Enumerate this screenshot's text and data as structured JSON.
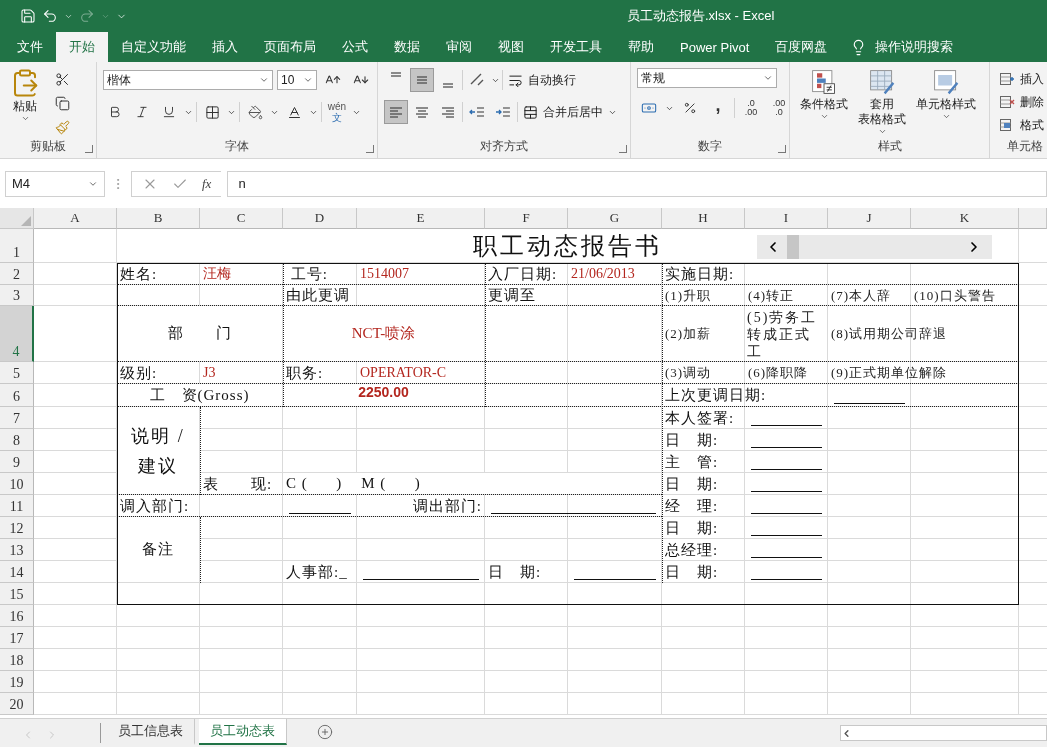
{
  "window": {
    "title": "员工动态报告.xlsx  -  Excel",
    "redo_enabled": false
  },
  "ribbon_tabs": [
    {
      "label": "文件",
      "selected": false
    },
    {
      "label": "开始",
      "selected": true
    },
    {
      "label": "自定义功能",
      "selected": false
    },
    {
      "label": "插入",
      "selected": false
    },
    {
      "label": "页面布局",
      "selected": false
    },
    {
      "label": "公式",
      "selected": false
    },
    {
      "label": "数据",
      "selected": false
    },
    {
      "label": "审阅",
      "selected": false
    },
    {
      "label": "视图",
      "selected": false
    },
    {
      "label": "开发工具",
      "selected": false
    },
    {
      "label": "帮助",
      "selected": false
    },
    {
      "label": "Power Pivot",
      "selected": false
    },
    {
      "label": "百度网盘",
      "selected": false
    }
  ],
  "tell_me": {
    "placeholder": "操作说明搜索"
  },
  "clipboard": {
    "label": "剪贴板",
    "paste": "粘贴"
  },
  "font": {
    "label": "字体",
    "font_name": "楷体",
    "font_size": "10",
    "phonetic_top": "wén",
    "phonetic_bottom": "文"
  },
  "alignment": {
    "label": "对齐方式",
    "vertical": [
      {
        "kind": "top",
        "selected": false
      },
      {
        "kind": "middle",
        "selected": true
      },
      {
        "kind": "bottom",
        "selected": false
      }
    ],
    "horizontal": [
      {
        "kind": "left",
        "selected": true
      },
      {
        "kind": "center",
        "selected": false
      },
      {
        "kind": "right",
        "selected": false
      }
    ],
    "wrap_text": "自动换行",
    "merge_center": "合并后居中"
  },
  "number": {
    "label": "数字",
    "format": "常规",
    "comma_glyph": ",",
    "increase_decimal": [
      ".0",
      ".00"
    ],
    "decrease_decimal": [
      ".00",
      ".0"
    ]
  },
  "styles": {
    "label": "样式",
    "buttons": [
      {
        "kind": "conditional",
        "lines": [
          "条件格式"
        ]
      },
      {
        "kind": "table",
        "lines": [
          "套用",
          "表格格式"
        ]
      },
      {
        "kind": "cell",
        "lines": [
          "单元格样式"
        ]
      }
    ]
  },
  "cells_group": {
    "label": "单元格",
    "buttons": [
      {
        "kind": "insert",
        "label": "插入"
      },
      {
        "kind": "delete",
        "label": "删除"
      },
      {
        "kind": "format",
        "label": "格式"
      }
    ]
  },
  "formula_bar": {
    "name_box": "M4",
    "function_glyph": "fx",
    "formula": "n"
  },
  "sheet": {
    "columns": [
      "A",
      "B",
      "C",
      "D",
      "E",
      "F",
      "G",
      "H",
      "I",
      "J",
      "K"
    ],
    "rows": [
      {
        "label": "1",
        "selected": false,
        "cells": [
          {
            "kind": "empty"
          },
          {
            "kind": "title",
            "text": "职工动态报告书"
          },
          {
            "kind": "merge_left"
          },
          {
            "kind": "merge_left"
          },
          {
            "kind": "merge_left"
          },
          {
            "kind": "merge_left"
          },
          {
            "kind": "merge_left"
          },
          {
            "kind": "merge_left"
          },
          {
            "kind": "merge_left"
          },
          {
            "kind": "merge_left"
          },
          {
            "kind": "merge_left"
          }
        ]
      },
      {
        "label": "2",
        "selected": false,
        "cells": [
          {
            "kind": "empty"
          },
          {
            "kind": "label",
            "text": "姓名:"
          },
          {
            "kind": "value",
            "text": "汪梅"
          },
          {
            "kind": "label",
            "text": " 工号:"
          },
          {
            "kind": "value",
            "text": "1514007"
          },
          {
            "kind": "label",
            "text": "入厂日期:"
          },
          {
            "kind": "value",
            "text": "21/06/2013"
          },
          {
            "kind": "label",
            "text": "实施日期:"
          }
        ]
      },
      {
        "label": "3",
        "selected": false,
        "cells": [
          {
            "kind": "empty"
          },
          {
            "kind": "empty"
          },
          {
            "kind": "empty"
          },
          {
            "kind": "label",
            "text": "由此更调"
          },
          {
            "kind": "empty"
          },
          {
            "kind": "label",
            "text": "更调至"
          },
          {
            "kind": "empty"
          },
          {
            "kind": "option",
            "text": "(1)升职"
          },
          {
            "kind": "option",
            "text": "(4)转正"
          },
          {
            "kind": "option",
            "text": "(7)本人辞"
          },
          {
            "kind": "option",
            "text": "(10)口头警告"
          }
        ]
      },
      {
        "label": "4",
        "selected": true,
        "cells": [
          {
            "kind": "empty"
          },
          {
            "kind": "heading",
            "text": "部　　门"
          },
          {
            "kind": "merge_left"
          },
          {
            "kind": "centered_value",
            "text": "NCT-喷涂"
          },
          {
            "kind": "merge_left"
          },
          {
            "kind": "empty"
          },
          {
            "kind": "empty"
          },
          {
            "kind": "option",
            "text": "(2)加薪"
          },
          {
            "kind": "wrapped_option",
            "text": "(5)劳务工转成正式工"
          },
          {
            "kind": "option",
            "text": "(8)试用期公司辞退"
          }
        ]
      },
      {
        "label": "5",
        "selected": false,
        "cells": [
          {
            "kind": "empty"
          },
          {
            "kind": "label",
            "text": "级别:"
          },
          {
            "kind": "value",
            "text": "J3"
          },
          {
            "kind": "label",
            "text": "职务:"
          },
          {
            "kind": "value",
            "text": "OPERATOR-C"
          },
          {
            "kind": "empty"
          },
          {
            "kind": "empty"
          },
          {
            "kind": "option",
            "text": "(3)调动"
          },
          {
            "kind": "option",
            "text": "(6)降职降"
          },
          {
            "kind": "option",
            "text": "(9)正式期单位解除"
          }
        ]
      },
      {
        "label": "6",
        "selected": false,
        "cells": [
          {
            "kind": "empty"
          },
          {
            "kind": "heading",
            "text": "工　资(Gross)"
          },
          {
            "kind": "merge_left"
          },
          {
            "kind": "amount",
            "text": "2250.00"
          },
          {
            "kind": "merge_left"
          },
          {
            "kind": "empty"
          },
          {
            "kind": "empty"
          },
          {
            "kind": "label",
            "text": "上次更调日期:"
          },
          {
            "kind": "empty"
          },
          {
            "kind": "blank"
          }
        ]
      },
      {
        "label": "7",
        "selected": false,
        "cells": [
          {
            "kind": "empty"
          },
          {
            "kind": "big_heading",
            "text": "说明 / 建议"
          },
          {
            "kind": "empty"
          },
          {
            "kind": "empty"
          },
          {
            "kind": "empty"
          },
          {
            "kind": "empty"
          },
          {
            "kind": "empty"
          },
          {
            "kind": "label",
            "text": "本人签署:"
          },
          {
            "kind": "blank"
          }
        ]
      },
      {
        "label": "8",
        "selected": false,
        "cells": [
          {
            "kind": "empty"
          },
          {
            "kind": "merge_up"
          },
          {
            "kind": "empty"
          },
          {
            "kind": "empty"
          },
          {
            "kind": "empty"
          },
          {
            "kind": "empty"
          },
          {
            "kind": "empty"
          },
          {
            "kind": "label",
            "text": "日　期:"
          },
          {
            "kind": "blank"
          }
        ]
      },
      {
        "label": "9",
        "selected": false,
        "cells": [
          {
            "kind": "empty"
          },
          {
            "kind": "merge_up"
          },
          {
            "kind": "empty"
          },
          {
            "kind": "empty"
          },
          {
            "kind": "empty"
          },
          {
            "kind": "empty"
          },
          {
            "kind": "empty"
          },
          {
            "kind": "label",
            "text": "主　管:"
          },
          {
            "kind": "blank"
          }
        ]
      },
      {
        "label": "10",
        "selected": false,
        "cells": [
          {
            "kind": "empty"
          },
          {
            "kind": "merge_up"
          },
          {
            "kind": "label",
            "text": "表　　现:"
          },
          {
            "kind": "label",
            "text": "C (      )    M (      )"
          },
          {
            "kind": "merge_left"
          },
          {
            "kind": "merge_left"
          },
          {
            "kind": "merge_left"
          },
          {
            "kind": "label",
            "text": "日　期:"
          },
          {
            "kind": "blank"
          }
        ]
      },
      {
        "label": "11",
        "selected": false,
        "cells": [
          {
            "kind": "empty"
          },
          {
            "kind": "label",
            "text": "调入部门:"
          },
          {
            "kind": "empty"
          },
          {
            "kind": "blank"
          },
          {
            "kind": "right_label",
            "text": "调出部门:"
          },
          {
            "kind": "blank"
          },
          {
            "kind": "merge_left"
          },
          {
            "kind": "label",
            "text": "经　理:"
          },
          {
            "kind": "blank"
          }
        ]
      },
      {
        "label": "12",
        "selected": false,
        "cells": [
          {
            "kind": "empty"
          },
          {
            "kind": "heading",
            "text": "备注"
          },
          {
            "kind": "empty"
          },
          {
            "kind": "empty"
          },
          {
            "kind": "empty"
          },
          {
            "kind": "empty"
          },
          {
            "kind": "empty"
          },
          {
            "kind": "label",
            "text": "日　期:"
          },
          {
            "kind": "blank"
          }
        ]
      },
      {
        "label": "13",
        "selected": false,
        "cells": [
          {
            "kind": "empty"
          },
          {
            "kind": "merge_up"
          },
          {
            "kind": "empty"
          },
          {
            "kind": "empty"
          },
          {
            "kind": "empty"
          },
          {
            "kind": "empty"
          },
          {
            "kind": "empty"
          },
          {
            "kind": "label",
            "text": "总经理:"
          },
          {
            "kind": "blank"
          }
        ]
      },
      {
        "label": "14",
        "selected": false,
        "cells": [
          {
            "kind": "empty"
          },
          {
            "kind": "merge_up"
          },
          {
            "kind": "empty"
          },
          {
            "kind": "label",
            "text": "人事部:_"
          },
          {
            "kind": "blank"
          },
          {
            "kind": "label",
            "text": "日　期:"
          },
          {
            "kind": "blank"
          },
          {
            "kind": "label",
            "text": "日　期:"
          },
          {
            "kind": "blank"
          }
        ]
      },
      {
        "label": "15",
        "selected": false
      },
      {
        "label": "16",
        "selected": false
      },
      {
        "label": "17",
        "selected": false
      },
      {
        "label": "18",
        "selected": false
      },
      {
        "label": "19",
        "selected": false
      },
      {
        "label": "20",
        "selected": false
      }
    ]
  },
  "sheet_tabs": [
    {
      "label": "员工信息表",
      "selected": false
    },
    {
      "label": "员工动态表",
      "selected": true
    }
  ]
}
